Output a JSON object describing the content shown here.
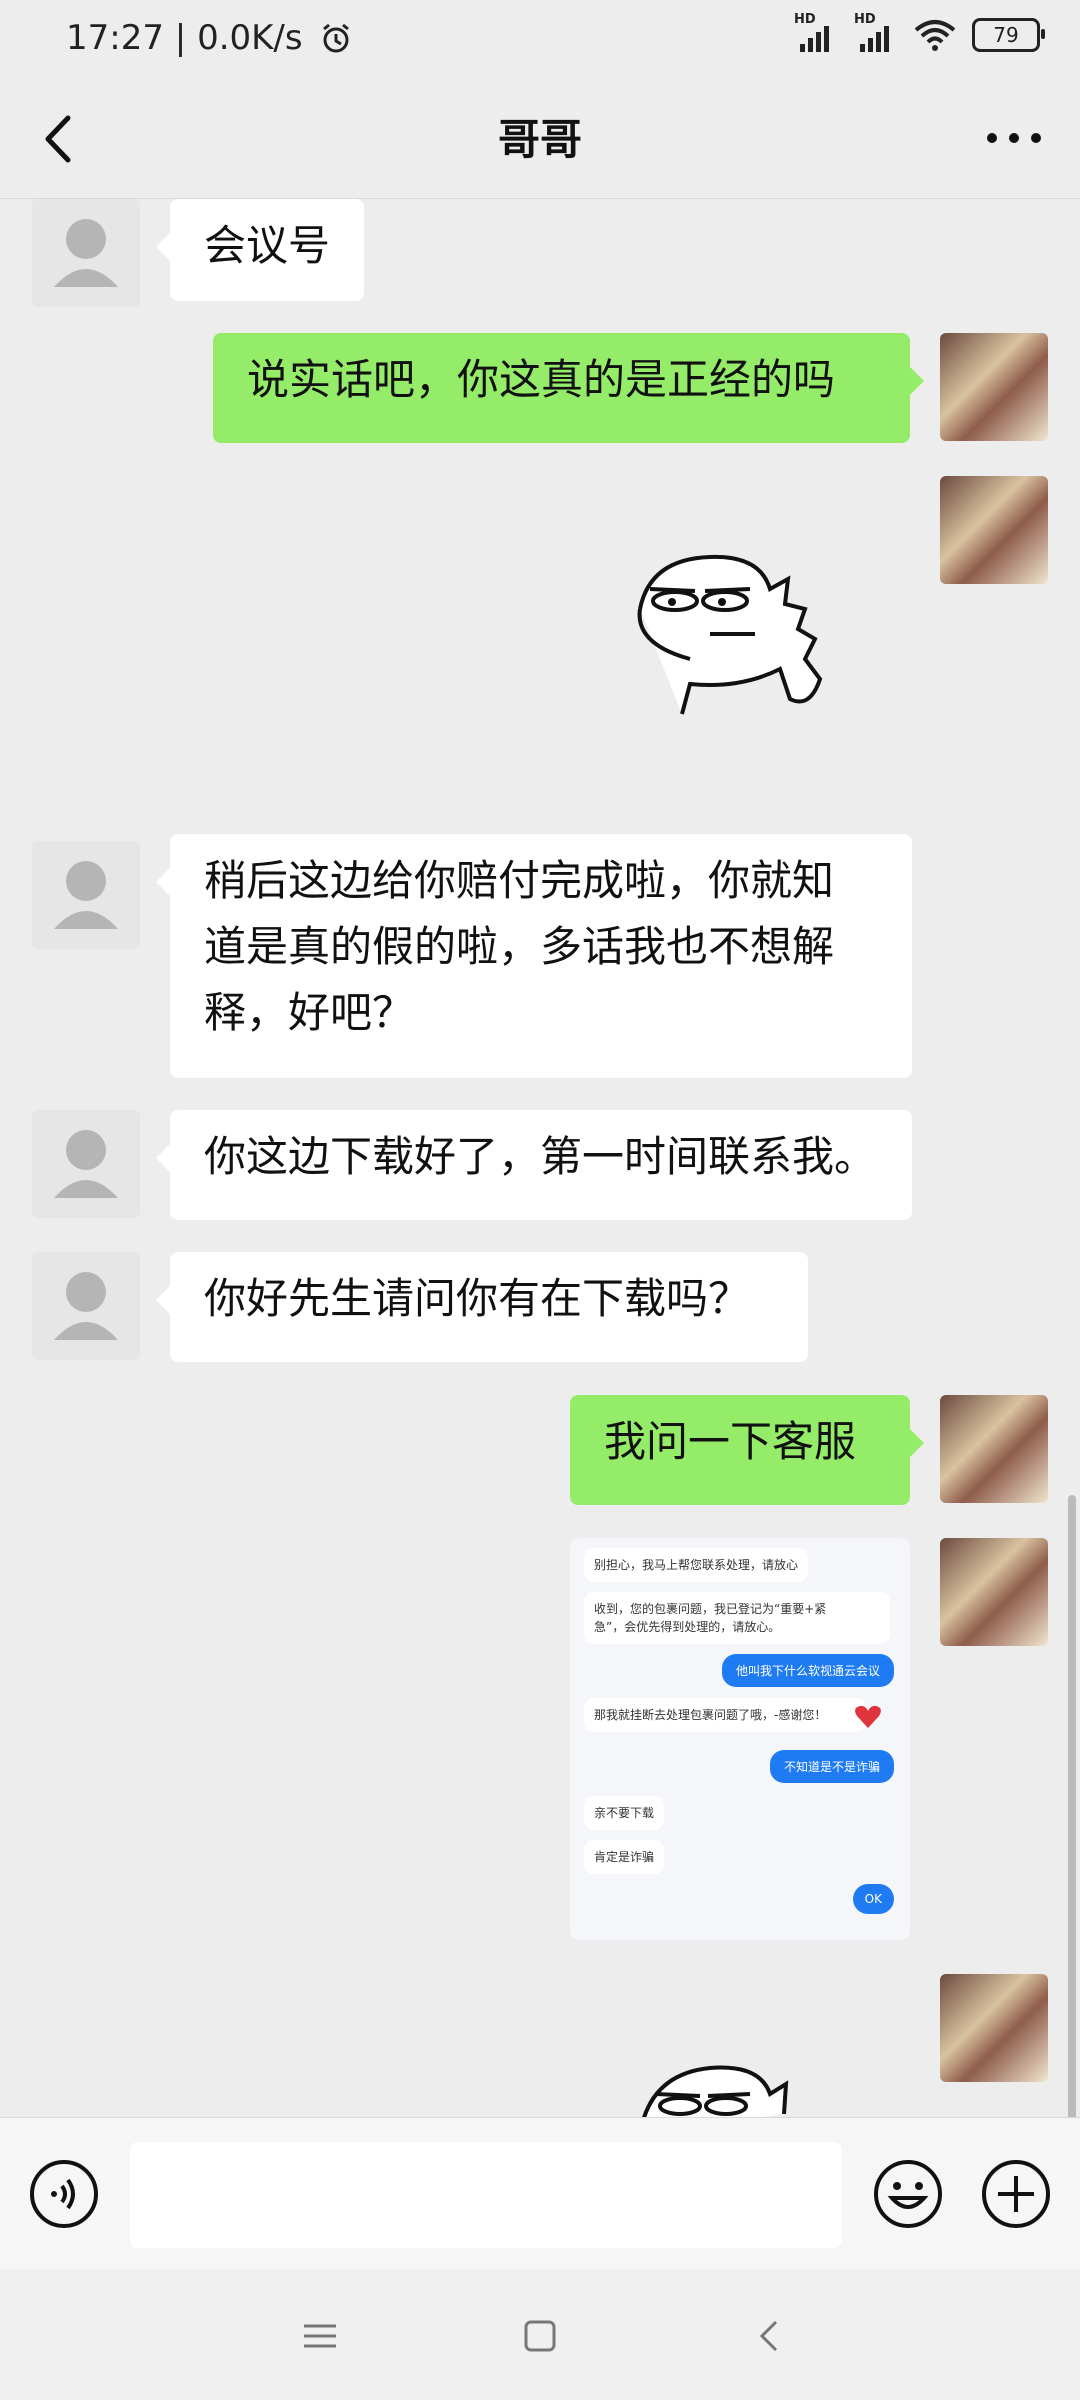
{
  "status_bar": {
    "time": "17:27",
    "speed": "0.0K/s",
    "sim1_label": "HD",
    "sim2_label": "HD",
    "battery": "79"
  },
  "header": {
    "title": "哥哥"
  },
  "messages": [
    {
      "side": "in",
      "type": "text",
      "text": "会议号"
    },
    {
      "side": "out",
      "type": "text",
      "text": "说实话吧，你这真的是正经的吗"
    },
    {
      "side": "out",
      "type": "sticker",
      "sticker": "dino-sticker"
    },
    {
      "side": "in",
      "type": "text",
      "lines": [
        "稍后这边给你赔付完成啦，你就知",
        "道是真的假的啦，多话我也不想解",
        "释，好吧？"
      ]
    },
    {
      "side": "in",
      "type": "text",
      "text": "你这边下载好了，第一时间联系我。"
    },
    {
      "side": "in",
      "type": "text",
      "text": "你好先生请问你有在下载吗？"
    },
    {
      "side": "out",
      "type": "text",
      "text": "我问一下客服"
    },
    {
      "side": "out",
      "type": "image",
      "screenshot": {
        "m1": "别担心，我马上帮您联系处理，请放心",
        "m2a": "收到，您的包裹问题，我已登记为“重要+紧",
        "m2b": "急”，会优先得到处理的，请放心。",
        "m3": "他叫我下什么软视通云会议",
        "m4": "那我就挂断去处理包裹问题了哦，-感谢您！",
        "m5": "不知道是不是诈骗",
        "m6": "亲不要下载",
        "m7": "肯定是诈骗",
        "m8": "OK"
      }
    },
    {
      "side": "out",
      "type": "sticker",
      "sticker": "dino-sticker"
    }
  ],
  "colors": {
    "chat_bg": "#ededed",
    "bubble_out": "#95ec69",
    "bubble_in": "#ffffff",
    "accent_blue": "#1f7bf2"
  },
  "icons": {
    "back": "chevron-left-icon",
    "more": "ellipsis-icon",
    "voice": "voice-icon",
    "emoji": "emoji-icon",
    "plus": "plus-icon",
    "nav_menu": "menu-icon",
    "nav_home": "home-square-icon",
    "nav_back": "back-chevron-icon"
  }
}
